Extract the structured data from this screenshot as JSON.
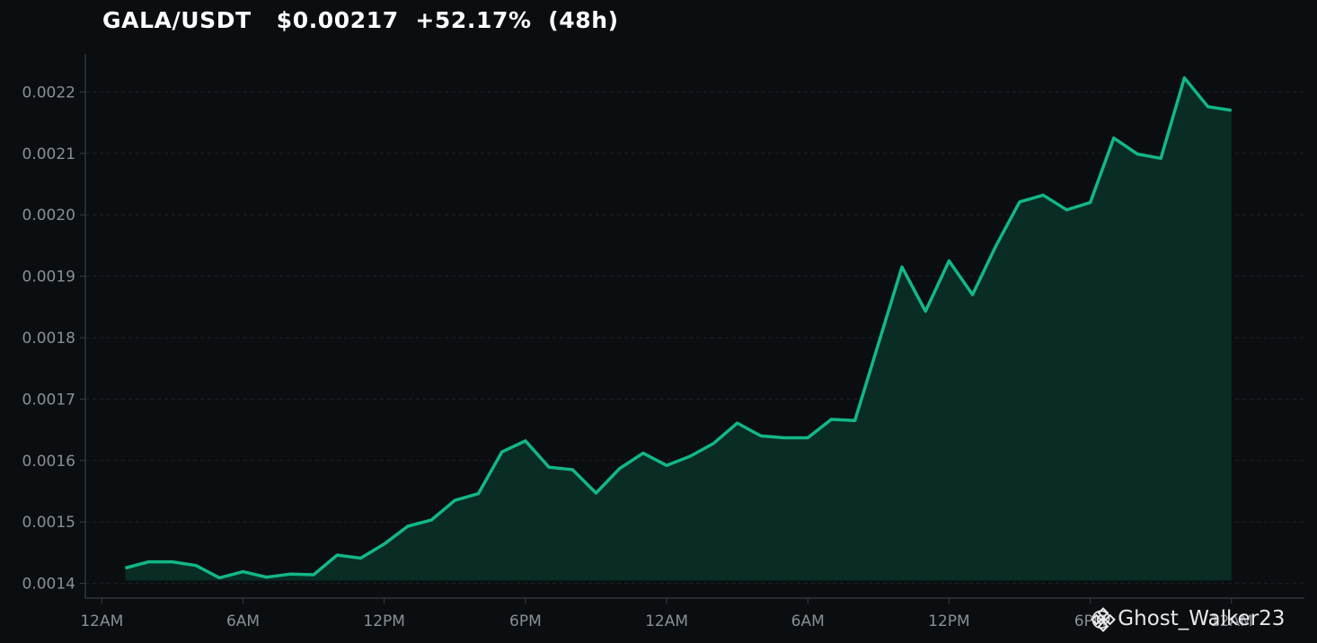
{
  "header": {
    "title": "GALA/USDT   $0.00217  +52.17%  (48h)"
  },
  "watermark": {
    "text": "@ Ghost_Walker23",
    "icon": "binance-logo-icon"
  },
  "colors": {
    "background": "#0b0e11",
    "line": "#12b886",
    "fill": "#0a2e26",
    "grid": "#1e2226",
    "axis": "#3a3f44",
    "tick_text": "#8a8f94"
  },
  "chart_data": {
    "type": "area",
    "title": "GALA/USDT   $0.00217  +52.17%  (48h)",
    "xlabel": "",
    "ylabel": "",
    "x_ticks": [
      "12AM",
      "6AM",
      "12PM",
      "6PM",
      "12AM",
      "6AM",
      "12PM",
      "6PM",
      "12AM"
    ],
    "y_ticks": [
      "0.0014",
      "0.0015",
      "0.0016",
      "0.0017",
      "0.0018",
      "0.0019",
      "0.0020",
      "0.0021",
      "0.0022"
    ],
    "xlim": [
      -0.7,
      51.1
    ],
    "ylim": [
      0.001376,
      0.002262
    ],
    "grid": true,
    "legend": "none",
    "series": [
      {
        "x": [
          1,
          2,
          3,
          4,
          5,
          6,
          7,
          8,
          9,
          10,
          11,
          12,
          13,
          14,
          15,
          16,
          17,
          18,
          19,
          20,
          21,
          22,
          23,
          24,
          25,
          26,
          27,
          28,
          29,
          30,
          31,
          32,
          33,
          34,
          35,
          36,
          37,
          38,
          39,
          40,
          41,
          42,
          43,
          44,
          45,
          46,
          47,
          48
        ],
        "values": [
          0.001425,
          0.001435,
          0.001435,
          0.001429,
          0.001409,
          0.001419,
          0.00141,
          0.001415,
          0.001414,
          0.001446,
          0.001441,
          0.001464,
          0.001493,
          0.001503,
          0.001535,
          0.001546,
          0.001614,
          0.001632,
          0.001589,
          0.001585,
          0.001547,
          0.001587,
          0.001612,
          0.001592,
          0.001607,
          0.001628,
          0.001661,
          0.00164,
          0.001637,
          0.001637,
          0.001667,
          0.001665,
          0.00179,
          0.001915,
          0.001843,
          0.001925,
          0.00187,
          0.00195,
          0.002021,
          0.002032,
          0.002008,
          0.00202,
          0.002125,
          0.002099,
          0.002092,
          0.002223,
          0.002176,
          0.00217
        ]
      }
    ]
  }
}
